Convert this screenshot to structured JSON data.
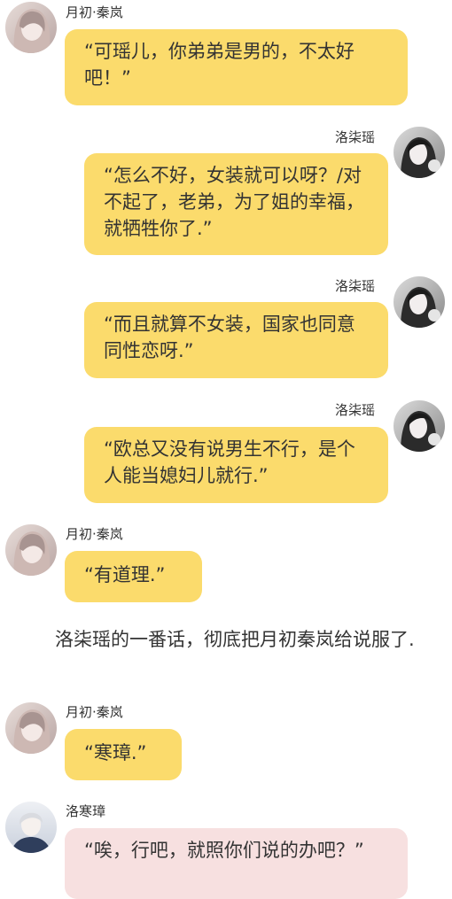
{
  "messages": [
    {
      "sender": "月初·秦岚",
      "text": "“可瑶儿，你弟弟是男的，不太好吧！”",
      "avatar": "yuechu-avatar"
    },
    {
      "sender": "洛柒瑶",
      "text": "“怎么不好，女装就可以呀？/对不起了，老弟，为了姐的幸福，就牺牲你了.”",
      "avatar": "luoqiyao-avatar"
    },
    {
      "sender": "洛柒瑶",
      "text": "“而且就算不女装，国家也同意同性恋呀.”",
      "avatar": "luoqiyao-avatar"
    },
    {
      "sender": "洛柒瑶",
      "text": "“欧总又没有说男生不行，是个人能当媳妇儿就行.”",
      "avatar": "luoqiyao-avatar"
    },
    {
      "sender": "月初·秦岚",
      "text": "“有道理.”",
      "avatar": "yuechu-avatar"
    },
    {
      "sender": "月初·秦岚",
      "text": "“寒璋.”",
      "avatar": "yuechu-avatar"
    },
    {
      "sender": "洛寒璋",
      "text": "“唉，行吧，就照你们说的办吧？”",
      "avatar": "luohanzhang-avatar"
    }
  ],
  "narration": "洛柒瑶的一番话，彻底把月初秦岚给说服了.",
  "colors": {
    "bubble_yellow": "#fbdb6c",
    "bubble_pink": "#f7e0e0"
  }
}
